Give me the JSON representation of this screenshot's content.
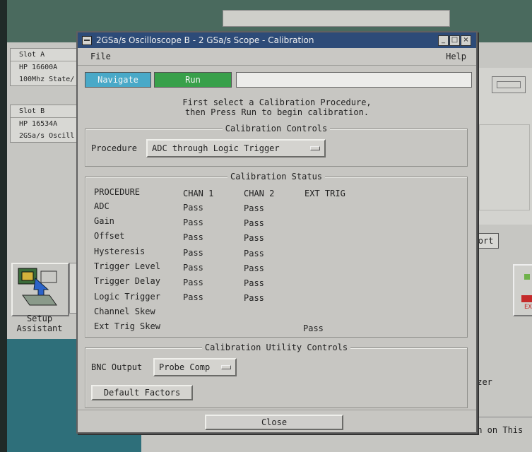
{
  "background": {
    "slot_a": {
      "title": "Slot A",
      "model": "HP 16600A",
      "desc": "100Mhz State/"
    },
    "slot_b": {
      "title": "Slot B",
      "model": "HP 16534A",
      "desc": "2GSa/s Oscill"
    },
    "setup_assistant_label": "Setup Assistant",
    "port_label": "Port",
    "ex_label": "EX",
    "yzer_text": "yzer",
    "on_this_text": "on on This"
  },
  "window": {
    "title": "2GSa/s Oscilloscope B - 2 GSa/s Scope - Calibration",
    "menu": {
      "file": "File",
      "help": "Help"
    },
    "nav": {
      "navigate": "Navigate",
      "run": "Run",
      "status_value": ""
    },
    "instructions": {
      "line1": "First select a Calibration Procedure,",
      "line2": "then Press Run to begin calibration."
    },
    "controls": {
      "title": "Calibration Controls",
      "procedure_label": "Procedure",
      "procedure_value": "ADC through Logic Trigger"
    },
    "status": {
      "title": "Calibration Status",
      "headers": [
        "PROCEDURE",
        "CHAN 1",
        "CHAN 2",
        "EXT TRIG"
      ],
      "rows": [
        {
          "procedure": "ADC",
          "chan1": "Pass",
          "chan2": "Pass",
          "ext": ""
        },
        {
          "procedure": "Gain",
          "chan1": "Pass",
          "chan2": "Pass",
          "ext": ""
        },
        {
          "procedure": "Offset",
          "chan1": "Pass",
          "chan2": "Pass",
          "ext": ""
        },
        {
          "procedure": "Hysteresis",
          "chan1": "Pass",
          "chan2": "Pass",
          "ext": ""
        },
        {
          "procedure": "Trigger Level",
          "chan1": "Pass",
          "chan2": "Pass",
          "ext": ""
        },
        {
          "procedure": "Trigger Delay",
          "chan1": "Pass",
          "chan2": "Pass",
          "ext": ""
        },
        {
          "procedure": "Logic Trigger",
          "chan1": "Pass",
          "chan2": "Pass",
          "ext": ""
        },
        {
          "procedure": "Channel Skew",
          "chan1": "",
          "chan2": "",
          "ext": ""
        },
        {
          "procedure": "Ext Trig Skew",
          "chan1": "",
          "chan2": "",
          "ext": "Pass"
        }
      ]
    },
    "utility": {
      "title": "Calibration Utility Controls",
      "bnc_label": "BNC Output",
      "bnc_value": "Probe Comp",
      "default_factors": "Default Factors"
    },
    "close_label": "Close"
  }
}
